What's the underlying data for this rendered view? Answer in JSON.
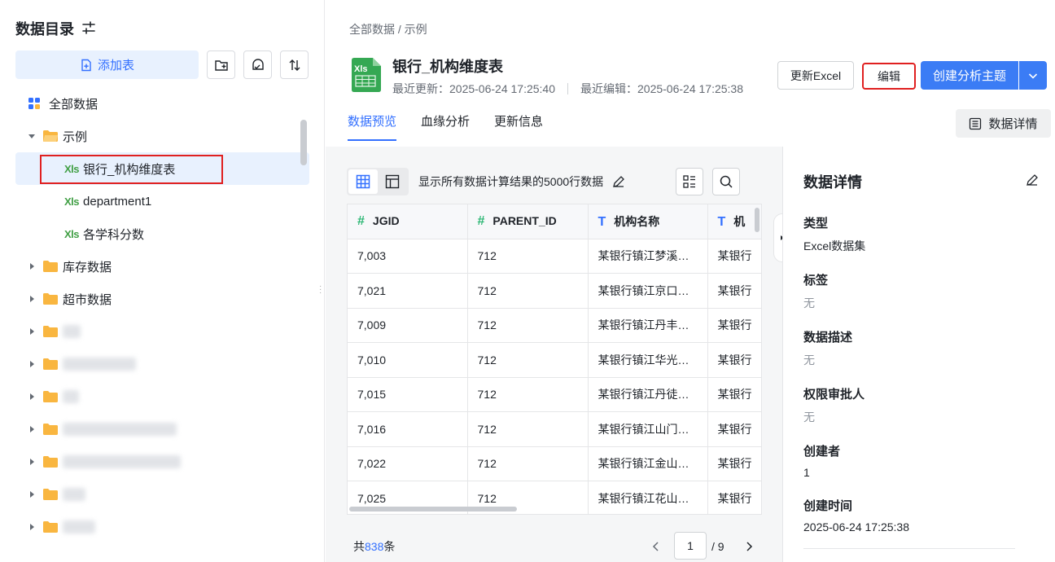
{
  "sidebar": {
    "title": "数据目录",
    "add_table_label": "添加表",
    "tree": {
      "all_data": "全部数据",
      "example_folder": "示例",
      "files": [
        "银行_机构维度表",
        "department1",
        "各学科分数"
      ],
      "xls_tag": "Xls",
      "folders": [
        "库存数据",
        "超市数据"
      ]
    }
  },
  "header": {
    "breadcrumb": "全部数据 / 示例",
    "title": "银行_机构维度表",
    "last_updated": "最近更新：2025-06-24 17:25:40",
    "last_edited": "最近编辑：2025-06-24 17:25:38",
    "update_excel_label": "更新Excel",
    "edit_label": "编辑",
    "create_topic_label": "创建分析主题",
    "tabs": [
      "数据预览",
      "血缘分析",
      "更新信息"
    ],
    "detail_button_label": "数据详情"
  },
  "preview": {
    "toolbar_text": "显示所有数据计算结果的5000行数据",
    "columns": [
      {
        "type": "#",
        "name": "JGID"
      },
      {
        "type": "#",
        "name": "PARENT_ID"
      },
      {
        "type": "T",
        "name": "机构名称"
      },
      {
        "type": "T",
        "name": "机"
      }
    ],
    "rows": [
      [
        "7,003",
        "712",
        "某银行镇江梦溪…",
        "某银行"
      ],
      [
        "7,021",
        "712",
        "某银行镇江京口…",
        "某银行"
      ],
      [
        "7,009",
        "712",
        "某银行镇江丹丰…",
        "某银行"
      ],
      [
        "7,010",
        "712",
        "某银行镇江华光…",
        "某银行"
      ],
      [
        "7,015",
        "712",
        "某银行镇江丹徒…",
        "某银行"
      ],
      [
        "7,016",
        "712",
        "某银行镇江山门…",
        "某银行"
      ],
      [
        "7,022",
        "712",
        "某银行镇江金山…",
        "某银行"
      ],
      [
        "7,025",
        "712",
        "某银行镇江花山…",
        "某银行"
      ]
    ],
    "pager": {
      "total_prefix": "共",
      "total_count": "838",
      "total_suffix": "条",
      "current_page": "1",
      "total_pages": "/ 9"
    }
  },
  "details": {
    "title": "数据详情",
    "fields": [
      {
        "label": "类型",
        "value": "Excel数据集",
        "empty": false
      },
      {
        "label": "标签",
        "value": "无",
        "empty": true
      },
      {
        "label": "数据描述",
        "value": "无",
        "empty": true
      },
      {
        "label": "权限审批人",
        "value": "无",
        "empty": true
      },
      {
        "label": "创建者",
        "value": "1",
        "empty": false
      },
      {
        "label": "创建时间",
        "value": "2025-06-24 17:25:38",
        "empty": false
      }
    ]
  },
  "colors": {
    "accent": "#3370ff",
    "primary_button": "#3b7cf5",
    "folder": "#f9b640",
    "xls_green": "#43a047",
    "highlight_box": "#e02020"
  }
}
